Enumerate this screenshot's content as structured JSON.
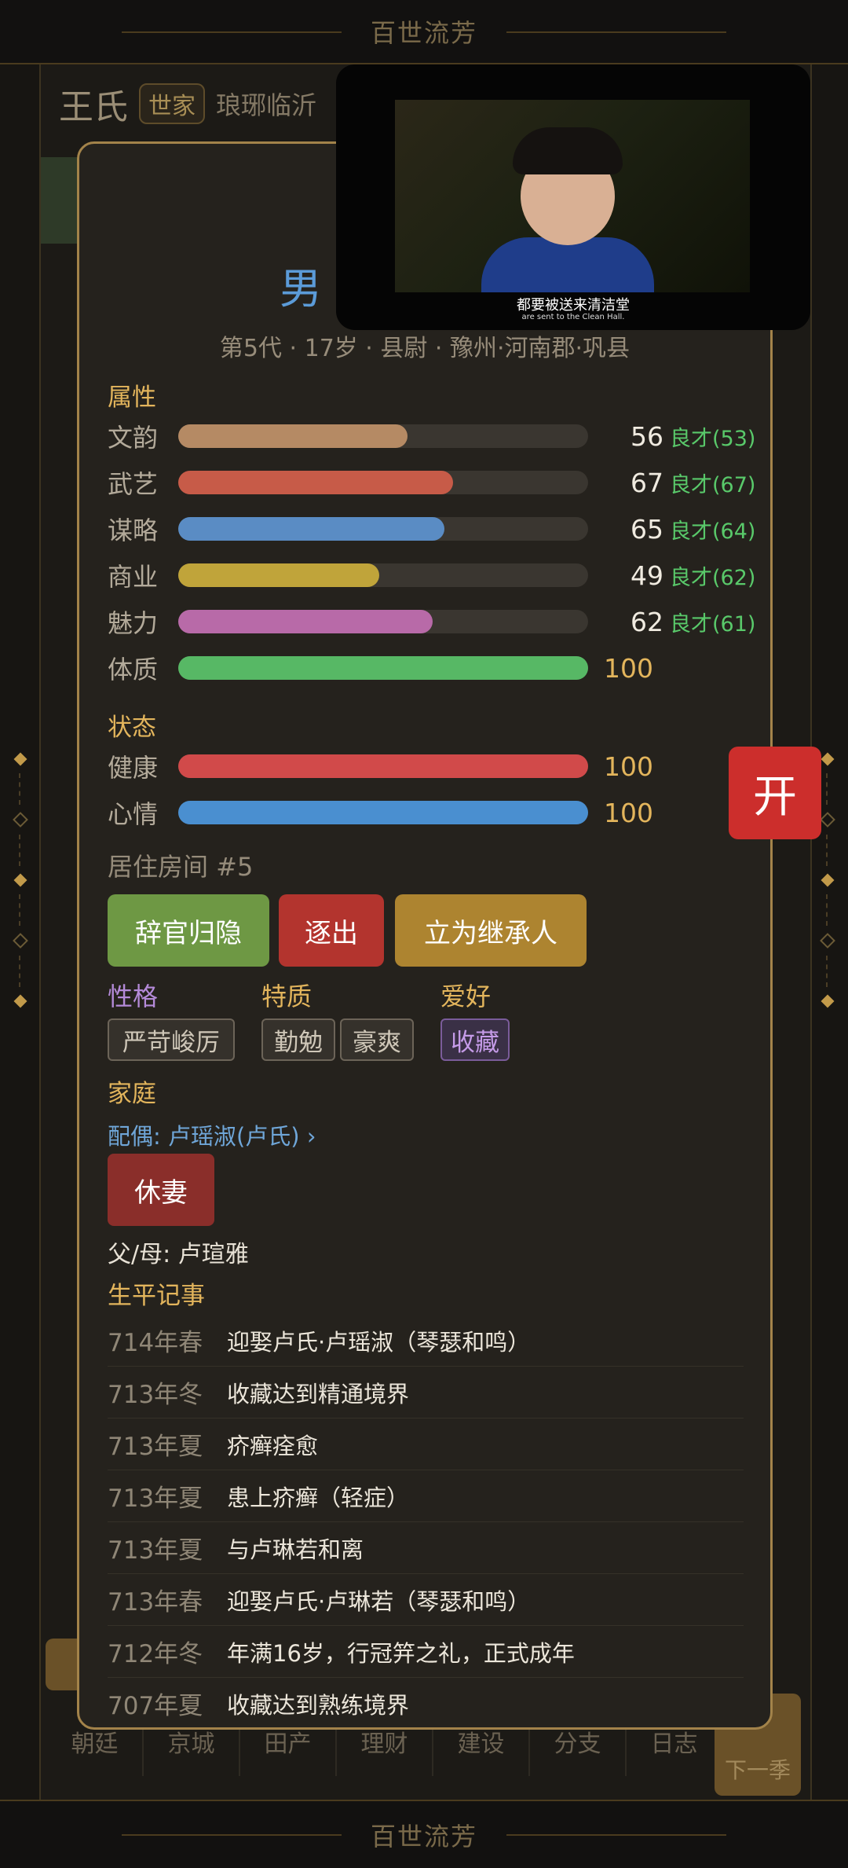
{
  "top_bar": {
    "title": "百世流芳"
  },
  "bottom_bar": {
    "title": "百世流芳"
  },
  "background": {
    "family_name": "王氏",
    "family_badge": "世家",
    "place": "琅琊临沂",
    "nav": [
      "朝廷",
      "京城",
      "田产",
      "理财",
      "建设",
      "分支",
      "日志"
    ],
    "next_season": "下一季"
  },
  "person": {
    "gender": "男",
    "meta": "第5代 · 17岁 · 县尉 · 豫州·河南郡·巩县"
  },
  "sections": {
    "attributes": "属性",
    "status": "状态",
    "family": "家庭",
    "events": "生平记事"
  },
  "attributes": [
    {
      "label": "文韵",
      "value": "56",
      "talent": "良才(53)",
      "pct": 56,
      "color": "#b58a64"
    },
    {
      "label": "武艺",
      "value": "67",
      "talent": "良才(67)",
      "pct": 67,
      "color": "#c75b48"
    },
    {
      "label": "谋略",
      "value": "65",
      "talent": "良才(64)",
      "pct": 65,
      "color": "#5a8cc4"
    },
    {
      "label": "商业",
      "value": "49",
      "talent": "良才(62)",
      "pct": 49,
      "color": "#c0a43a"
    },
    {
      "label": "魅力",
      "value": "62",
      "talent": "良才(61)",
      "pct": 62,
      "color": "#b86aa8"
    },
    {
      "label": "体质",
      "value": "100",
      "talent": "",
      "pct": 100,
      "color": "#57b865"
    }
  ],
  "status": [
    {
      "label": "健康",
      "value": "100",
      "pct": 100,
      "color": "#d14a4a"
    },
    {
      "label": "心情",
      "value": "100",
      "pct": 100,
      "color": "#4a8fd0"
    }
  ],
  "residence": "居住房间 #5",
  "actions": {
    "resign": "辞官归隐",
    "expel": "逐出",
    "heir": "立为继承人"
  },
  "traits": {
    "personality_head": "性格",
    "quality_head": "特质",
    "hobby_head": "爱好",
    "personality": "严苛峻厉",
    "quality1": "勤勉",
    "quality2": "豪爽",
    "hobby": "收藏"
  },
  "family": {
    "spouse": "配偶: 卢瑶淑(卢氏) ›",
    "divorce": "休妻",
    "parents": "父/母: 卢瑄雅"
  },
  "events": [
    {
      "date": "714年春",
      "text": "迎娶卢氏·卢瑶淑（琴瑟和鸣）"
    },
    {
      "date": "713年冬",
      "text": "收藏达到精通境界"
    },
    {
      "date": "713年夏",
      "text": "疥癣痊愈"
    },
    {
      "date": "713年夏",
      "text": "患上疥癣（轻症）"
    },
    {
      "date": "713年夏",
      "text": "与卢琳若和离"
    },
    {
      "date": "713年春",
      "text": "迎娶卢氏·卢琳若（琴瑟和鸣）"
    },
    {
      "date": "712年冬",
      "text": "年满16岁，行冠笄之礼，正式成年"
    },
    {
      "date": "707年夏",
      "text": "收藏达到熟练境界"
    }
  ],
  "video": {
    "subtitle_cn": "都要被送来清洁堂",
    "subtitle_en": "are sent to the Clean Hall."
  },
  "open_button": "开"
}
